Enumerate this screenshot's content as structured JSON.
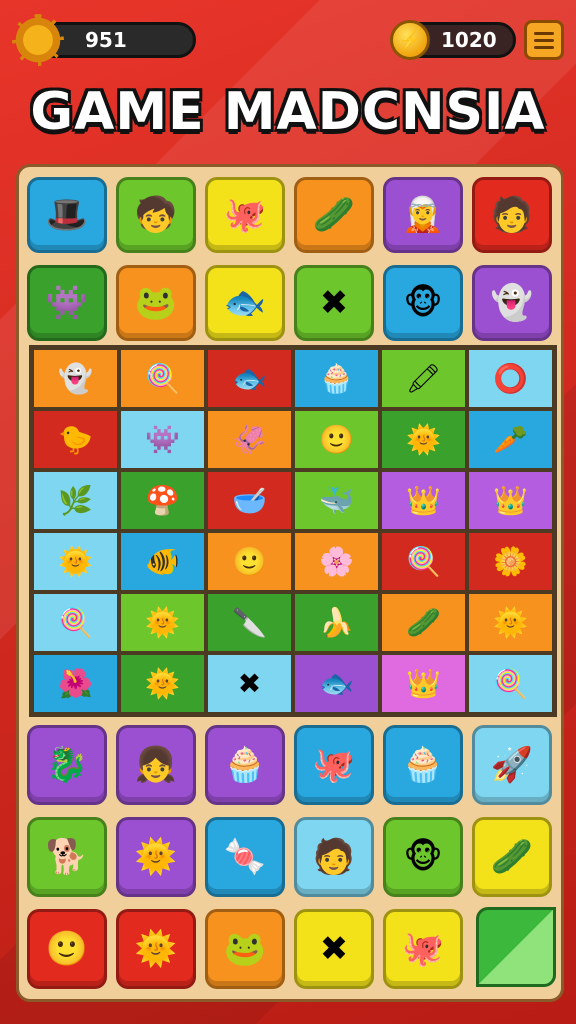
{
  "hud": {
    "settings_icon": "gear-icon",
    "score": "951",
    "coin_icon": "coin-icon",
    "coins": "1020",
    "menu_icon": "hamburger-menu-icon"
  },
  "title": "GAME MADCNSIA",
  "top_tiles": [
    [
      {
        "color": "#29a8e0",
        "icon": "🎩"
      },
      {
        "color": "#6cc62c",
        "icon": "🧒"
      },
      {
        "color": "#f3e21a",
        "icon": "🐙"
      },
      {
        "color": "#f7921e",
        "icon": "🥒"
      },
      {
        "color": "#9b4fd1",
        "icon": "🧝"
      },
      {
        "color": "#e32a1f",
        "icon": "🧑"
      }
    ],
    [
      {
        "color": "#3aa12c",
        "icon": "👾"
      },
      {
        "color": "#f7921e",
        "icon": "🐸"
      },
      {
        "color": "#f3e21a",
        "icon": "🐟"
      },
      {
        "color": "#6cc62c",
        "icon": "✖"
      },
      {
        "color": "#29a8e0",
        "icon": "🐵"
      },
      {
        "color": "#9b4fd1",
        "icon": "👻"
      }
    ]
  ],
  "mid_grid": [
    [
      {
        "color": "#f7921e",
        "icon": "👻"
      },
      {
        "color": "#f7921e",
        "icon": "🍭"
      },
      {
        "color": "#d32a1f",
        "icon": "🐟"
      },
      {
        "color": "#29a8e0",
        "icon": "🧁"
      },
      {
        "color": "#6cc62c",
        "icon": "🖍"
      },
      {
        "color": "#7fd6f0",
        "icon": "⭕"
      }
    ],
    [
      {
        "color": "#d32a1f",
        "icon": "🐤"
      },
      {
        "color": "#7fd6f0",
        "icon": "👾"
      },
      {
        "color": "#f7921e",
        "icon": "🦑"
      },
      {
        "color": "#6cc62c",
        "icon": "🙂"
      },
      {
        "color": "#3aa12c",
        "icon": "🌞"
      },
      {
        "color": "#29a8e0",
        "icon": "🥕"
      }
    ],
    [
      {
        "color": "#7fd6f0",
        "icon": "🌿"
      },
      {
        "color": "#3aa12c",
        "icon": "🍄"
      },
      {
        "color": "#d32a1f",
        "icon": "🥣"
      },
      {
        "color": "#6cc62c",
        "icon": "🐳"
      },
      {
        "color": "#b45de0",
        "icon": "👑"
      },
      {
        "color": "#b45de0",
        "icon": "👑"
      }
    ],
    [
      {
        "color": "#7fd6f0",
        "icon": "🌞"
      },
      {
        "color": "#29a8e0",
        "icon": "🐠"
      },
      {
        "color": "#f7921e",
        "icon": "🙂"
      },
      {
        "color": "#f7921e",
        "icon": "🌸"
      },
      {
        "color": "#d32a1f",
        "icon": "🍭"
      },
      {
        "color": "#d32a1f",
        "icon": "🌼"
      }
    ],
    [
      {
        "color": "#7fd6f0",
        "icon": "🍭"
      },
      {
        "color": "#6cc62c",
        "icon": "🌞"
      },
      {
        "color": "#3aa12c",
        "icon": "🔪"
      },
      {
        "color": "#3aa12c",
        "icon": "🍌"
      },
      {
        "color": "#f7921e",
        "icon": "🥒"
      },
      {
        "color": "#f7921e",
        "icon": "🌞"
      }
    ],
    [
      {
        "color": "#29a8e0",
        "icon": "🌺"
      },
      {
        "color": "#3aa12c",
        "icon": "🌞"
      },
      {
        "color": "#7fd6f0",
        "icon": "✖"
      },
      {
        "color": "#9b4fd1",
        "icon": "🐟"
      },
      {
        "color": "#e06be0",
        "icon": "👑"
      },
      {
        "color": "#7fd6f0",
        "icon": "🍭"
      }
    ]
  ],
  "bottom_tiles": [
    [
      {
        "color": "#9b4fd1",
        "icon": "🐉"
      },
      {
        "color": "#9b4fd1",
        "icon": "👧"
      },
      {
        "color": "#9b4fd1",
        "icon": "🧁"
      },
      {
        "color": "#29a8e0",
        "icon": "🐙"
      },
      {
        "color": "#29a8e0",
        "icon": "🧁"
      },
      {
        "color": "#7fd6f0",
        "icon": "🚀"
      }
    ],
    [
      {
        "color": "#6cc62c",
        "icon": "🐕"
      },
      {
        "color": "#9b4fd1",
        "icon": "🌞"
      },
      {
        "color": "#29a8e0",
        "icon": "🍬"
      },
      {
        "color": "#7fd6f0",
        "icon": "🧑"
      },
      {
        "color": "#6cc62c",
        "icon": "🐵"
      },
      {
        "color": "#f3e21a",
        "icon": "🥒"
      }
    ],
    [
      {
        "color": "#e32a1f",
        "icon": "🙂"
      },
      {
        "color": "#e32a1f",
        "icon": "🌞"
      },
      {
        "color": "#f7921e",
        "icon": "🐸"
      },
      {
        "color": "#f3e21a",
        "icon": "✖"
      },
      {
        "color": "#f3e21a",
        "icon": "🐙"
      },
      {
        "color": "#3aa12c",
        "icon": ""
      }
    ]
  ]
}
